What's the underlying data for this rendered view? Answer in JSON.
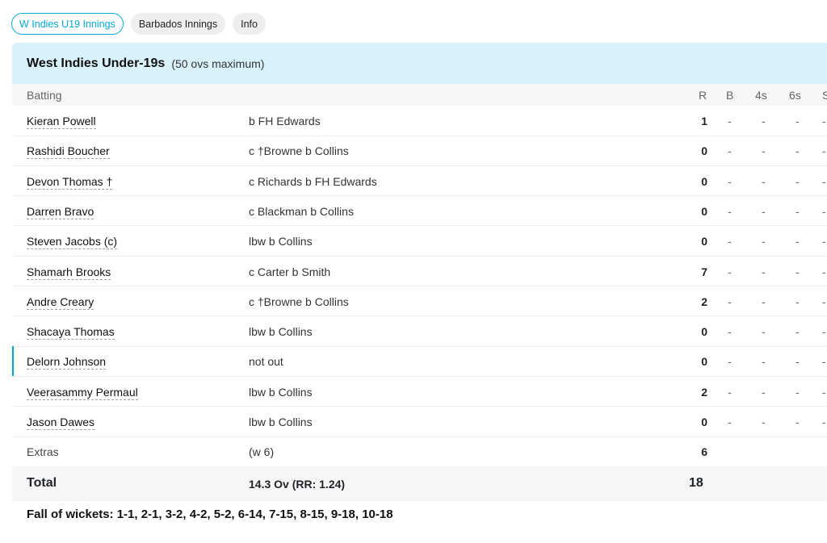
{
  "tabs": [
    {
      "label": "W Indies U19 Innings",
      "active": true
    },
    {
      "label": "Barbados Innings",
      "active": false
    },
    {
      "label": "Info",
      "active": false
    }
  ],
  "header": {
    "team": "West Indies Under-19s",
    "overs_note": "(50 ovs maximum)"
  },
  "columns": {
    "batting": "Batting",
    "runs": "R",
    "balls": "B",
    "fours": "4s",
    "sixes": "6s",
    "strike_rate": "S"
  },
  "batters": [
    {
      "name": "Kieran Powell",
      "dismissal": "b FH Edwards",
      "r": "1",
      "b": "-",
      "fours": "-",
      "sixes": "-",
      "sr": "-"
    },
    {
      "name": "Rashidi Boucher",
      "dismissal": "c †Browne b Collins",
      "r": "0",
      "b": "-",
      "fours": "-",
      "sixes": "-",
      "sr": "-"
    },
    {
      "name": "Devon Thomas †",
      "dismissal": "c Richards b FH Edwards",
      "r": "0",
      "b": "-",
      "fours": "-",
      "sixes": "-",
      "sr": "-"
    },
    {
      "name": "Darren Bravo",
      "dismissal": "c Blackman b Collins",
      "r": "0",
      "b": "-",
      "fours": "-",
      "sixes": "-",
      "sr": "-"
    },
    {
      "name": "Steven Jacobs (c)",
      "dismissal": "lbw b Collins",
      "r": "0",
      "b": "-",
      "fours": "-",
      "sixes": "-",
      "sr": "-"
    },
    {
      "name": "Shamarh Brooks",
      "dismissal": "c Carter b Smith",
      "r": "7",
      "b": "-",
      "fours": "-",
      "sixes": "-",
      "sr": "-"
    },
    {
      "name": "Andre Creary",
      "dismissal": "c †Browne b Collins",
      "r": "2",
      "b": "-",
      "fours": "-",
      "sixes": "-",
      "sr": "-"
    },
    {
      "name": "Shacaya Thomas",
      "dismissal": "lbw b Collins",
      "r": "0",
      "b": "-",
      "fours": "-",
      "sixes": "-",
      "sr": "-"
    },
    {
      "name": "Delorn Johnson",
      "dismissal": "not out",
      "r": "0",
      "b": "-",
      "fours": "-",
      "sixes": "-",
      "sr": "-",
      "not_out": true
    },
    {
      "name": "Veerasammy Permaul",
      "dismissal": "lbw b Collins",
      "r": "2",
      "b": "-",
      "fours": "-",
      "sixes": "-",
      "sr": "-"
    },
    {
      "name": "Jason Dawes",
      "dismissal": "lbw b Collins",
      "r": "0",
      "b": "-",
      "fours": "-",
      "sixes": "-",
      "sr": "-"
    }
  ],
  "extras": {
    "label": "Extras",
    "detail": "(w 6)",
    "runs": "6"
  },
  "total": {
    "label": "Total",
    "overs": "14.3 Ov (RR: 1.24)",
    "runs": "18"
  },
  "fall_of_wickets": "Fall of wickets: 1-1, 2-1, 3-2, 4-2, 5-2, 6-14, 7-15, 8-15, 9-18, 10-18",
  "colors": {
    "accent": "#03a9d8",
    "header_bg": "#d8f1fb"
  }
}
